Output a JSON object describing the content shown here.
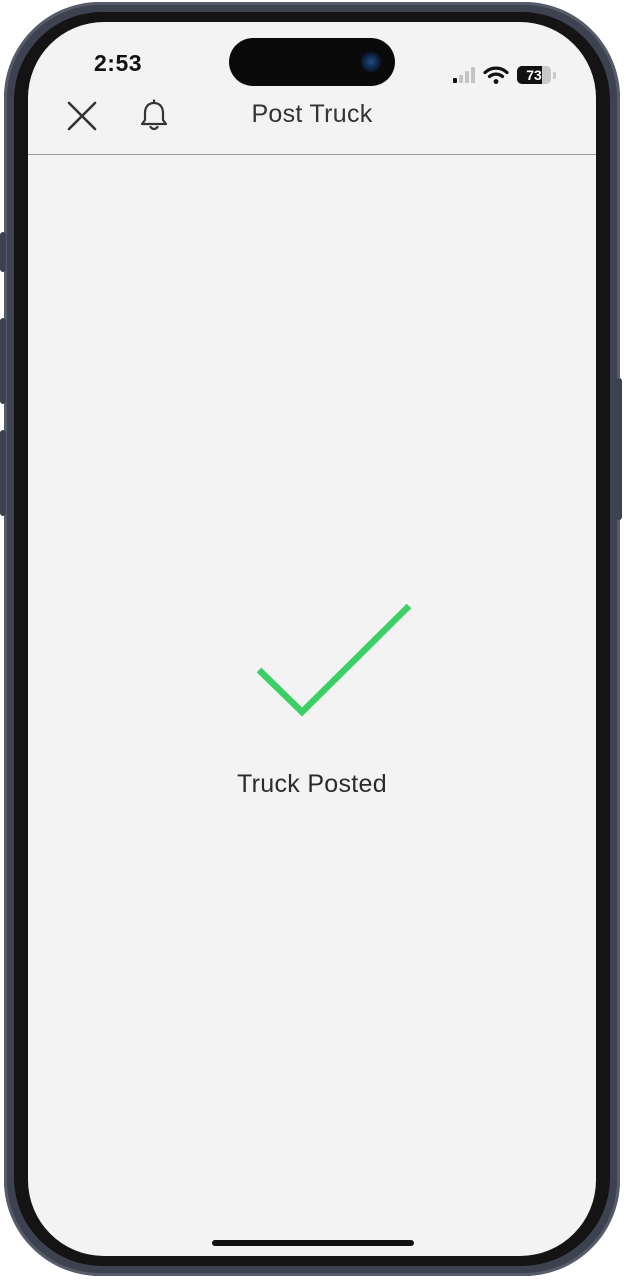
{
  "status_bar": {
    "time": "2:53",
    "battery_level": "73",
    "signal_icon": "cellular-signal-icon",
    "wifi_icon": "wifi-icon",
    "battery_icon": "battery-icon"
  },
  "header": {
    "title": "Post Truck",
    "close_icon": "close-icon",
    "notification_icon": "bell-icon"
  },
  "main": {
    "success_icon": "checkmark-icon",
    "message": "Truck Posted"
  },
  "colors": {
    "success": "#3ccf66",
    "screen_background": "#f3f3f3",
    "text_primary": "#2b2b2b"
  }
}
